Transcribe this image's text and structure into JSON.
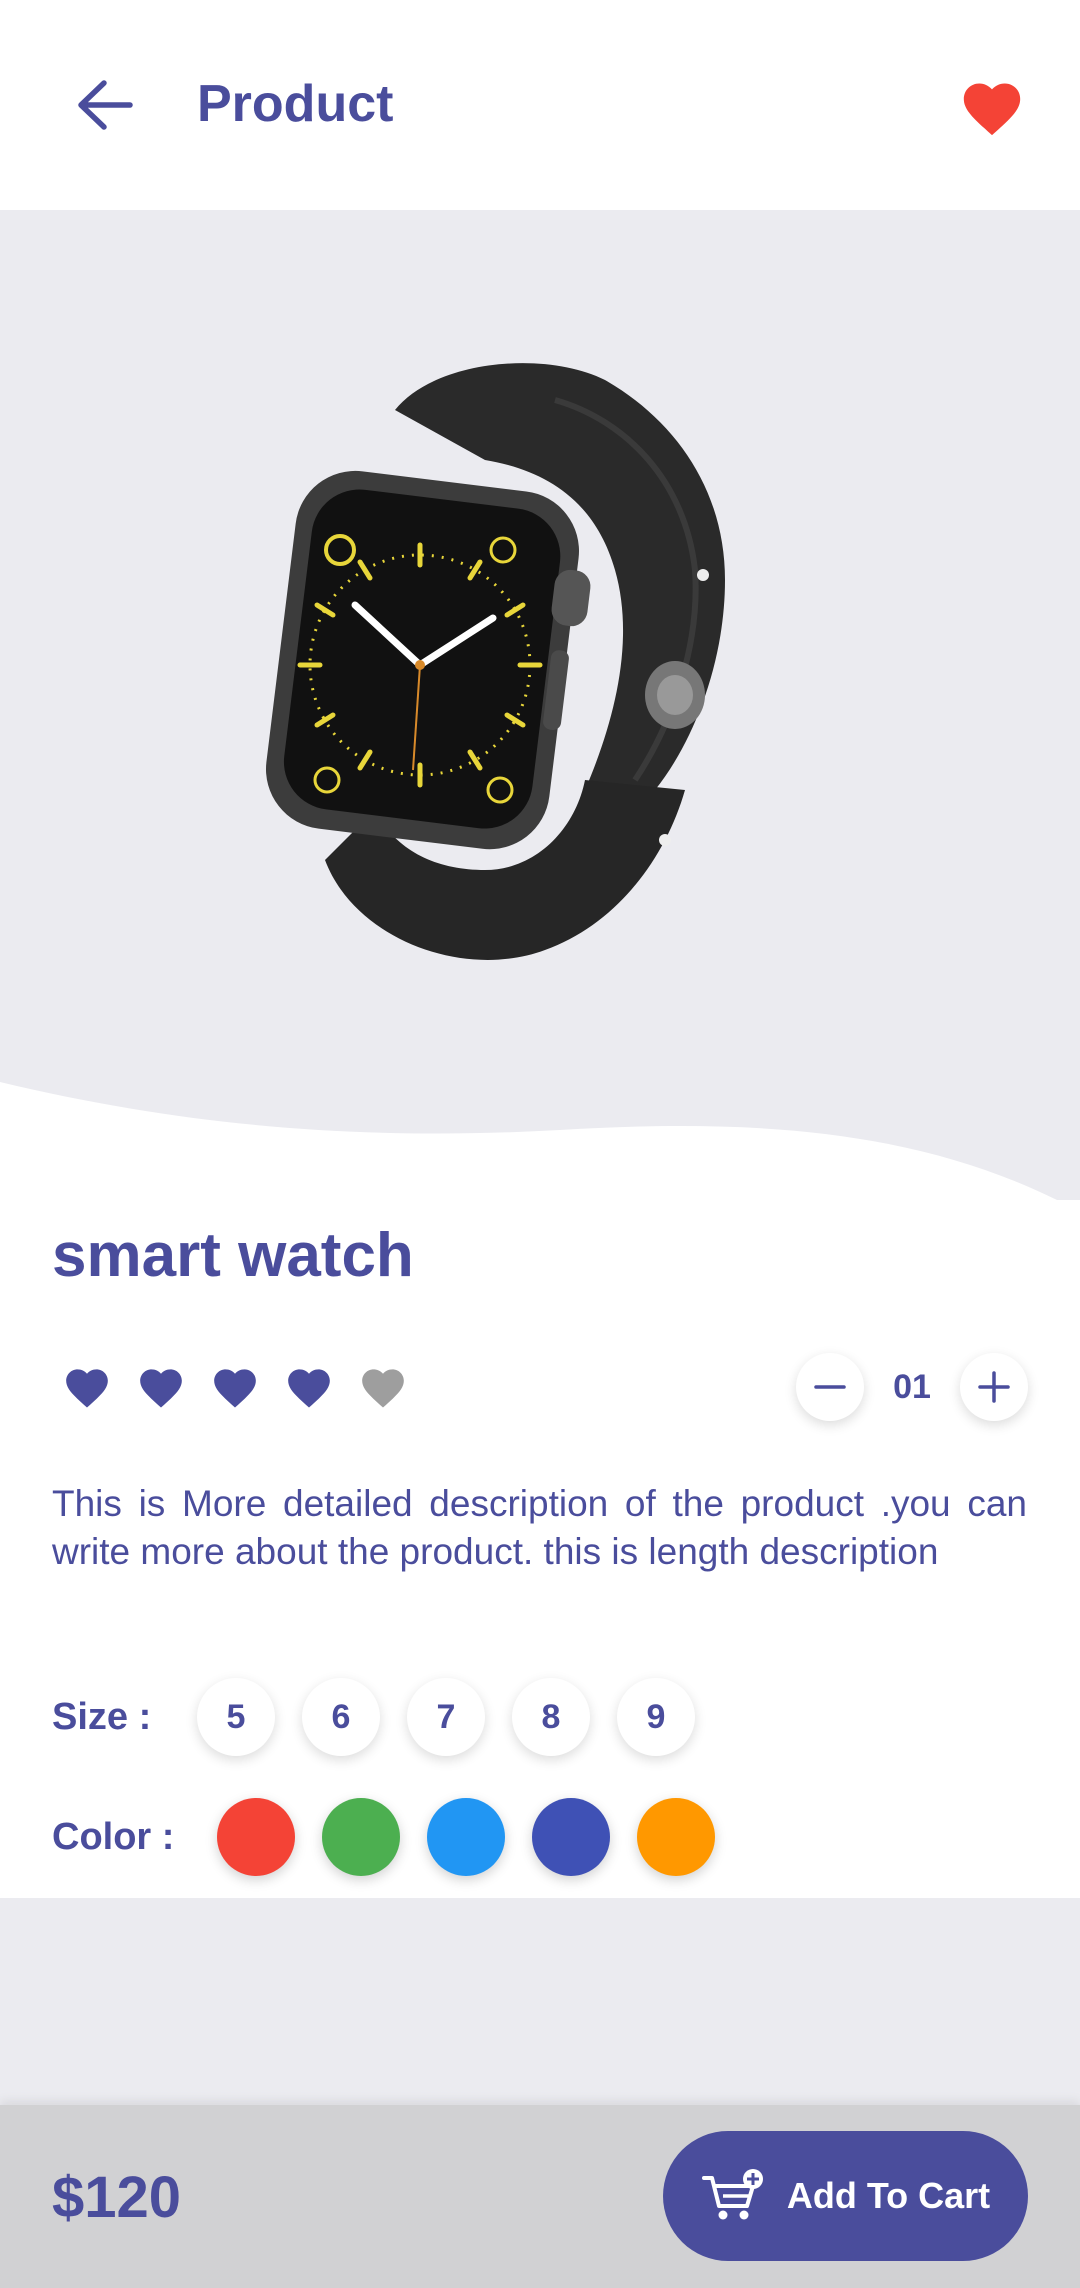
{
  "header": {
    "title": "Product",
    "back_icon": "arrow-left-icon",
    "favorite_icon": "heart-icon"
  },
  "product": {
    "name": "smart watch",
    "rating": 4,
    "rating_max": 5,
    "quantity": "01",
    "description": "This is More detailed description of the product .you can write more about the product. this is length description",
    "size_label": "Size :",
    "sizes": [
      "5",
      "6",
      "7",
      "8",
      "9"
    ],
    "color_label": "Color :",
    "colors": [
      "#f44336",
      "#4caf50",
      "#2196f3",
      "#3f51b5",
      "#ff9800"
    ]
  },
  "footer": {
    "price": "$120",
    "cart_label": "Add To Cart",
    "cart_icon": "cart-plus-icon"
  },
  "theme": {
    "primary": "#4a4d9c",
    "favorite": "#f44336",
    "rating_off": "#9e9e9e"
  }
}
